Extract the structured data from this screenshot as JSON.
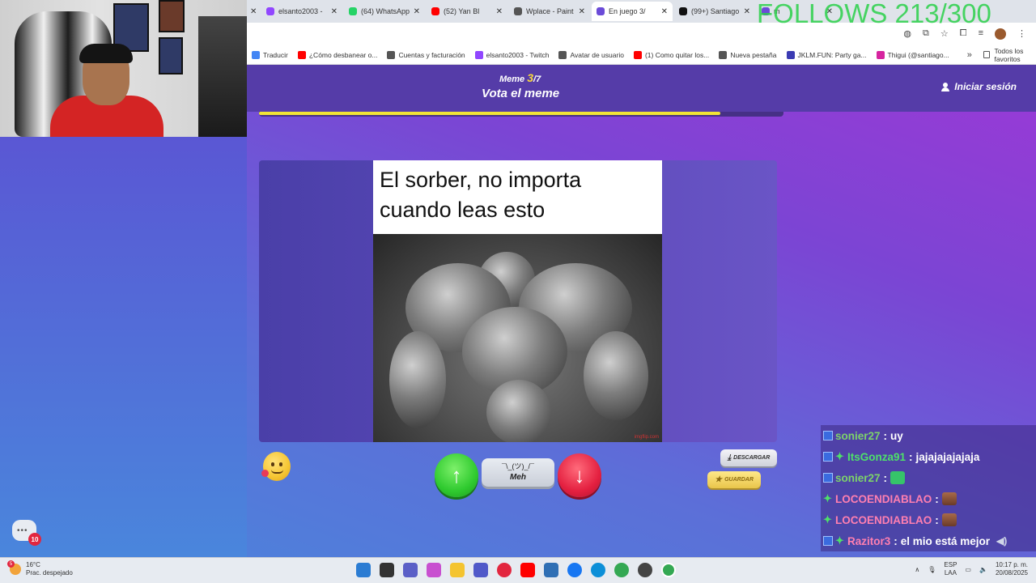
{
  "overlay": {
    "follows": "FOLLOWS 213/300"
  },
  "browser": {
    "tabs": [
      {
        "title": "elsanto2003 -",
        "color": "#9147ff",
        "active": false
      },
      {
        "title": "(64) WhatsApp",
        "color": "#25d366",
        "active": false
      },
      {
        "title": "(52) Yan Bl",
        "color": "#ff0000",
        "active": false
      },
      {
        "title": "Wplace - Paint",
        "color": "#555555",
        "active": false
      },
      {
        "title": "En juego 3/",
        "color": "#6b4bd8",
        "active": true
      },
      {
        "title": "(99+) Santiago",
        "color": "#111111",
        "active": false
      },
      {
        "title": "m",
        "color": "#6b4bd8",
        "active": false
      }
    ],
    "bookmarks": [
      {
        "label": "Traducir",
        "color": "#4285f4"
      },
      {
        "label": "¿Cómo desbanear o...",
        "color": "#ff0000"
      },
      {
        "label": "Cuentas y facturación",
        "color": "#555555"
      },
      {
        "label": "elsanto2003 - Twitch",
        "color": "#9147ff"
      },
      {
        "label": "Avatar de usuario",
        "color": "#555555"
      },
      {
        "label": "(1) Como quitar los...",
        "color": "#ff0000"
      },
      {
        "label": "Nueva pestaña",
        "color": "#555555"
      },
      {
        "label": "JKLM.FUN: Party ga...",
        "color": "#3b3bb3"
      },
      {
        "label": "Thigui (@santiago...",
        "color": "#d6249f"
      }
    ],
    "all_bookmarks": "Todos los favoritos"
  },
  "game": {
    "meme_label": "Meme",
    "meme_current": "3",
    "meme_total": "/7",
    "title": "Vota el meme",
    "login": "Iniciar sesión",
    "progress": 0.88,
    "caption": "El sorber, no importa cuando leas esto",
    "watermark": "imgflip.com",
    "meh_face": "¯\\_(ツ)_/¯",
    "meh_label": "Meh",
    "download": "DESCARGAR",
    "save": "GUARDAR",
    "chat_badge": "10"
  },
  "chat": [
    {
      "user": "sonier27",
      "msg": "uy",
      "badge": "mod",
      "color": "#7dd36a"
    },
    {
      "user": "ItsGonza91",
      "msg": "jajajajajajaja",
      "badge": "mod+sub",
      "color": "#4ee06a"
    },
    {
      "user": "sonier27",
      "msg": "",
      "badge": "mod",
      "color": "#7dd36a",
      "emote": "green"
    },
    {
      "user": "LOCOENDIABLAO",
      "msg": "",
      "badge": "sub",
      "color": "#ff7fb0",
      "emote": "face"
    },
    {
      "user": "LOCOENDIABLAO",
      "msg": "",
      "badge": "sub",
      "color": "#ff7fb0",
      "emote": "face"
    },
    {
      "user": "Razitor3",
      "msg": "el mio está mejor",
      "badge": "mod+sub",
      "color": "#ff7fb0"
    }
  ],
  "taskbar": {
    "temp": "16°C",
    "weather": "Prac. despejado",
    "weather_badge": "5",
    "lang1": "ESP",
    "lang2": "LAA",
    "time": "10:17 p. m.",
    "date": "20/08/2025"
  }
}
